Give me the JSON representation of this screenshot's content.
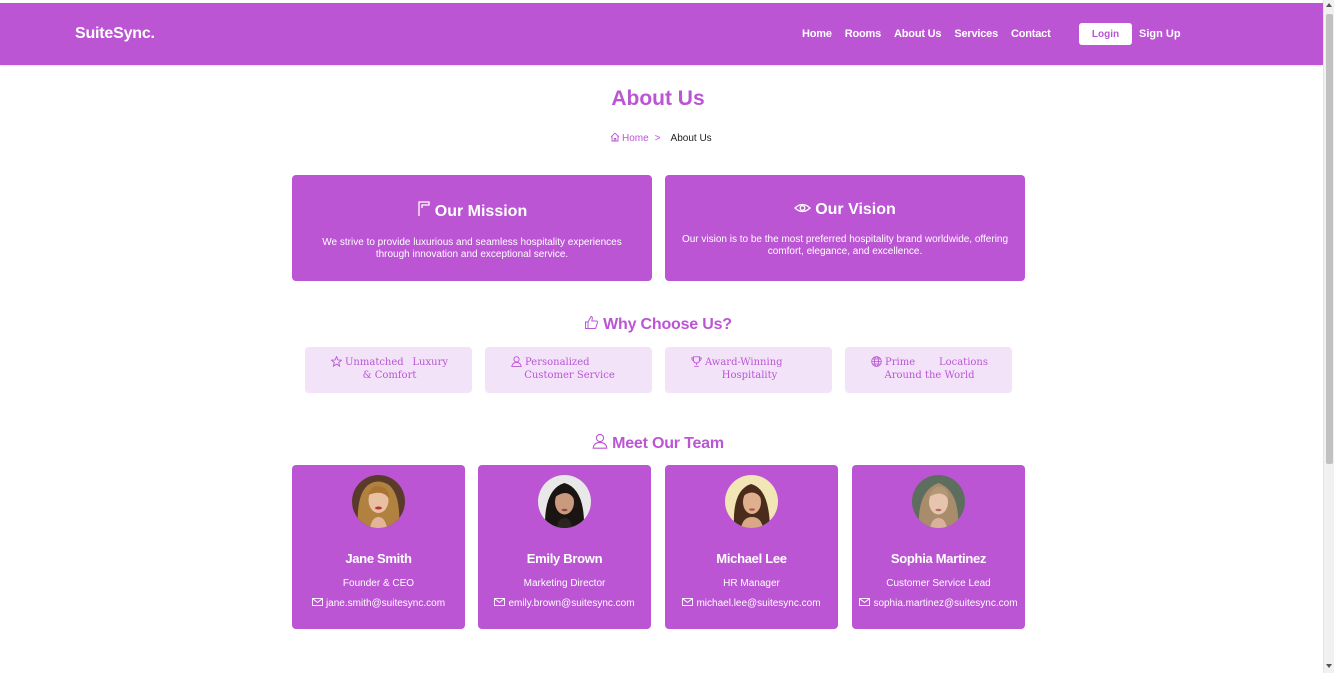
{
  "header": {
    "brand": "SuiteSync.",
    "nav": [
      "Home",
      "Rooms",
      "About Us",
      "Services",
      "Contact"
    ],
    "login_label": "Login",
    "signup_label": "Sign Up"
  },
  "page": {
    "title": "About Us",
    "breadcrumb": {
      "home": "Home",
      "separator": ">",
      "current": "About Us"
    }
  },
  "mission": {
    "title": "Our Mission",
    "icon": "flag-icon",
    "text": "We strive to provide luxurious and seamless hospitality experiences through innovation and exceptional service."
  },
  "vision": {
    "title": "Our Vision",
    "icon": "eye-icon",
    "text": "Our vision is to be the most preferred hospitality brand worldwide, offering comfort, elegance, and excellence."
  },
  "why": {
    "title": "Why Choose Us?",
    "icon": "thumbs-up-icon",
    "items": [
      {
        "icon": "star-icon",
        "label": "Unmatched Luxury & Comfort"
      },
      {
        "icon": "person-icon",
        "label": "Personalized Customer Service"
      },
      {
        "icon": "trophy-icon",
        "label": "Award-Winning Hospitality"
      },
      {
        "icon": "globe-icon",
        "label": "Prime Locations Around the World"
      }
    ]
  },
  "team": {
    "title": "Meet Our Team",
    "icon": "person-icon",
    "members": [
      {
        "name": "Jane Smith",
        "role": "Founder & CEO",
        "email": "jane.smith@suitesync.com"
      },
      {
        "name": "Emily Brown",
        "role": "Marketing Director",
        "email": "emily.brown@suitesync.com"
      },
      {
        "name": "Michael Lee",
        "role": "HR Manager",
        "email": "michael.lee@suitesync.com"
      },
      {
        "name": "Sophia Martinez",
        "role": "Customer Service Lead",
        "email": "sophia.martinez@suitesync.com"
      }
    ]
  },
  "colors": {
    "accent": "#bb55d4",
    "feature_bg": "#f2e3f9",
    "text": "#222222"
  }
}
